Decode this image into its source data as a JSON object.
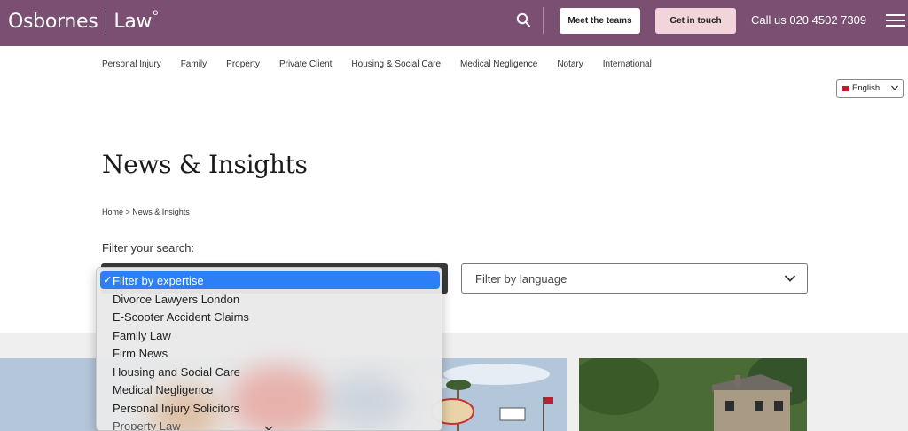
{
  "header": {
    "logo_left": "Osbornes",
    "logo_right": "Law",
    "logo_mark": "o",
    "meet_teams": "Meet the teams",
    "get_in_touch": "Get in touch",
    "call_us": "Call us 020 4502 7309",
    "bg_color": "#7a4f71"
  },
  "nav": {
    "items": [
      "Personal Injury",
      "Family",
      "Property",
      "Private Client",
      "Housing & Social Care",
      "Medical Negligence",
      "Notary",
      "International"
    ]
  },
  "language": {
    "selected": "English"
  },
  "page": {
    "title": "News & Insights",
    "breadcrumb": "Home > News & Insights",
    "filter_label": "Filter your search:"
  },
  "filters": {
    "language_placeholder": "Filter by language",
    "expertise_options": [
      "Filter by expertise",
      "Divorce Lawyers London",
      "E-Scooter Accident Claims",
      "Family Law",
      "Firm News",
      "Housing and Social Care",
      "Medical Negligence",
      "Personal Injury Solicitors",
      "Property Law"
    ],
    "expertise_selected_index": 0,
    "selected_color": "#2c7ff5"
  }
}
